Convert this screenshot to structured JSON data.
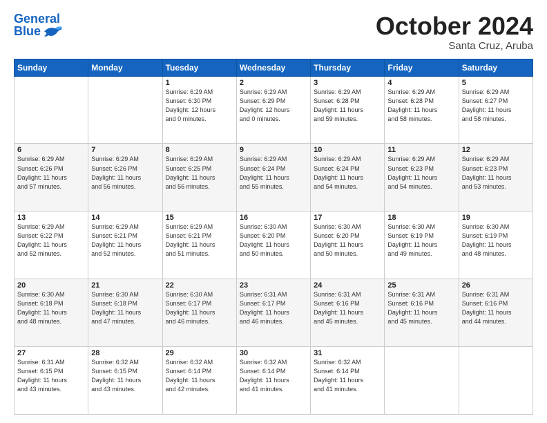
{
  "header": {
    "logo_line1": "General",
    "logo_line2": "Blue",
    "month": "October 2024",
    "location": "Santa Cruz, Aruba"
  },
  "weekdays": [
    "Sunday",
    "Monday",
    "Tuesday",
    "Wednesday",
    "Thursday",
    "Friday",
    "Saturday"
  ],
  "weeks": [
    [
      {
        "day": "",
        "info": ""
      },
      {
        "day": "",
        "info": ""
      },
      {
        "day": "1",
        "info": "Sunrise: 6:29 AM\nSunset: 6:30 PM\nDaylight: 12 hours\nand 0 minutes."
      },
      {
        "day": "2",
        "info": "Sunrise: 6:29 AM\nSunset: 6:29 PM\nDaylight: 12 hours\nand 0 minutes."
      },
      {
        "day": "3",
        "info": "Sunrise: 6:29 AM\nSunset: 6:28 PM\nDaylight: 11 hours\nand 59 minutes."
      },
      {
        "day": "4",
        "info": "Sunrise: 6:29 AM\nSunset: 6:28 PM\nDaylight: 11 hours\nand 58 minutes."
      },
      {
        "day": "5",
        "info": "Sunrise: 6:29 AM\nSunset: 6:27 PM\nDaylight: 11 hours\nand 58 minutes."
      }
    ],
    [
      {
        "day": "6",
        "info": "Sunrise: 6:29 AM\nSunset: 6:26 PM\nDaylight: 11 hours\nand 57 minutes."
      },
      {
        "day": "7",
        "info": "Sunrise: 6:29 AM\nSunset: 6:26 PM\nDaylight: 11 hours\nand 56 minutes."
      },
      {
        "day": "8",
        "info": "Sunrise: 6:29 AM\nSunset: 6:25 PM\nDaylight: 11 hours\nand 56 minutes."
      },
      {
        "day": "9",
        "info": "Sunrise: 6:29 AM\nSunset: 6:24 PM\nDaylight: 11 hours\nand 55 minutes."
      },
      {
        "day": "10",
        "info": "Sunrise: 6:29 AM\nSunset: 6:24 PM\nDaylight: 11 hours\nand 54 minutes."
      },
      {
        "day": "11",
        "info": "Sunrise: 6:29 AM\nSunset: 6:23 PM\nDaylight: 11 hours\nand 54 minutes."
      },
      {
        "day": "12",
        "info": "Sunrise: 6:29 AM\nSunset: 6:23 PM\nDaylight: 11 hours\nand 53 minutes."
      }
    ],
    [
      {
        "day": "13",
        "info": "Sunrise: 6:29 AM\nSunset: 6:22 PM\nDaylight: 11 hours\nand 52 minutes."
      },
      {
        "day": "14",
        "info": "Sunrise: 6:29 AM\nSunset: 6:21 PM\nDaylight: 11 hours\nand 52 minutes."
      },
      {
        "day": "15",
        "info": "Sunrise: 6:29 AM\nSunset: 6:21 PM\nDaylight: 11 hours\nand 51 minutes."
      },
      {
        "day": "16",
        "info": "Sunrise: 6:30 AM\nSunset: 6:20 PM\nDaylight: 11 hours\nand 50 minutes."
      },
      {
        "day": "17",
        "info": "Sunrise: 6:30 AM\nSunset: 6:20 PM\nDaylight: 11 hours\nand 50 minutes."
      },
      {
        "day": "18",
        "info": "Sunrise: 6:30 AM\nSunset: 6:19 PM\nDaylight: 11 hours\nand 49 minutes."
      },
      {
        "day": "19",
        "info": "Sunrise: 6:30 AM\nSunset: 6:19 PM\nDaylight: 11 hours\nand 48 minutes."
      }
    ],
    [
      {
        "day": "20",
        "info": "Sunrise: 6:30 AM\nSunset: 6:18 PM\nDaylight: 11 hours\nand 48 minutes."
      },
      {
        "day": "21",
        "info": "Sunrise: 6:30 AM\nSunset: 6:18 PM\nDaylight: 11 hours\nand 47 minutes."
      },
      {
        "day": "22",
        "info": "Sunrise: 6:30 AM\nSunset: 6:17 PM\nDaylight: 11 hours\nand 46 minutes."
      },
      {
        "day": "23",
        "info": "Sunrise: 6:31 AM\nSunset: 6:17 PM\nDaylight: 11 hours\nand 46 minutes."
      },
      {
        "day": "24",
        "info": "Sunrise: 6:31 AM\nSunset: 6:16 PM\nDaylight: 11 hours\nand 45 minutes."
      },
      {
        "day": "25",
        "info": "Sunrise: 6:31 AM\nSunset: 6:16 PM\nDaylight: 11 hours\nand 45 minutes."
      },
      {
        "day": "26",
        "info": "Sunrise: 6:31 AM\nSunset: 6:16 PM\nDaylight: 11 hours\nand 44 minutes."
      }
    ],
    [
      {
        "day": "27",
        "info": "Sunrise: 6:31 AM\nSunset: 6:15 PM\nDaylight: 11 hours\nand 43 minutes."
      },
      {
        "day": "28",
        "info": "Sunrise: 6:32 AM\nSunset: 6:15 PM\nDaylight: 11 hours\nand 43 minutes."
      },
      {
        "day": "29",
        "info": "Sunrise: 6:32 AM\nSunset: 6:14 PM\nDaylight: 11 hours\nand 42 minutes."
      },
      {
        "day": "30",
        "info": "Sunrise: 6:32 AM\nSunset: 6:14 PM\nDaylight: 11 hours\nand 41 minutes."
      },
      {
        "day": "31",
        "info": "Sunrise: 6:32 AM\nSunset: 6:14 PM\nDaylight: 11 hours\nand 41 minutes."
      },
      {
        "day": "",
        "info": ""
      },
      {
        "day": "",
        "info": ""
      }
    ]
  ]
}
